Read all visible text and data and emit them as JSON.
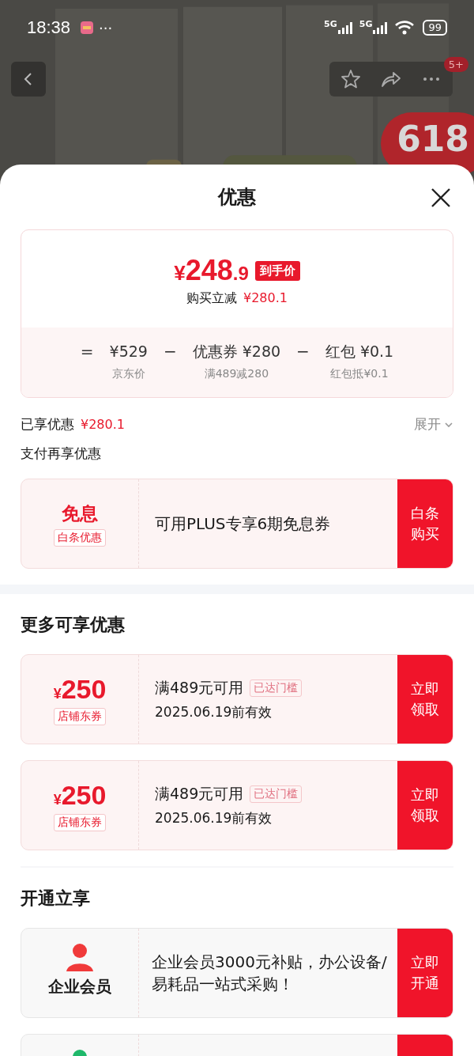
{
  "status_bar": {
    "time": "18:38",
    "more": "···",
    "signals": [
      "5G",
      "5G"
    ],
    "battery": "99"
  },
  "top_nav": {
    "badge": "5+",
    "promo_badge": "618"
  },
  "sheet": {
    "title": "优惠"
  },
  "summary": {
    "price_currency": "¥",
    "price_integer": "248",
    "price_decimal": ".9",
    "price_tag": "到手价",
    "reduce_label": "购买立减",
    "reduce_amount": "¥280.1",
    "breakdown": [
      {
        "op": "=",
        "value": "¥529",
        "note": "京东价"
      },
      {
        "op": "−",
        "value": "优惠券 ¥280",
        "note": "满489减280"
      },
      {
        "op": "−",
        "value": "红包 ¥0.1",
        "note": "红包抵¥0.1"
      }
    ]
  },
  "enjoyed": {
    "label": "已享优惠",
    "amount": "¥280.1",
    "expand": "展开",
    "expanded": false
  },
  "pay_section": {
    "title": "支付再享优惠",
    "cards": [
      {
        "kind": "interest",
        "main": "免息",
        "tag": "白条优惠",
        "text": "可用PLUS专享6期免息券",
        "button": "白条购买"
      }
    ]
  },
  "more_section": {
    "title": "更多可享优惠",
    "cards": [
      {
        "kind": "coupon",
        "currency": "¥",
        "amount": "250",
        "tag": "店铺东券",
        "condition": "满489元可用",
        "status": "已达门槛",
        "validity": "2025.06.19前有效",
        "button": "立即领取"
      },
      {
        "kind": "coupon",
        "currency": "¥",
        "amount": "250",
        "tag": "店铺东券",
        "condition": "满489元可用",
        "status": "已达门槛",
        "validity": "2025.06.19前有效",
        "button": "立即领取"
      }
    ]
  },
  "open_section": {
    "title": "开通立享",
    "cards": [
      {
        "kind": "member",
        "color": "#f03a3a",
        "label": "企业会员",
        "text": "企业会员3000元补贴，办公设备/易耗品一站式采购！",
        "button": "立即开通"
      },
      {
        "kind": "member",
        "color": "#1fb86a"
      }
    ]
  }
}
